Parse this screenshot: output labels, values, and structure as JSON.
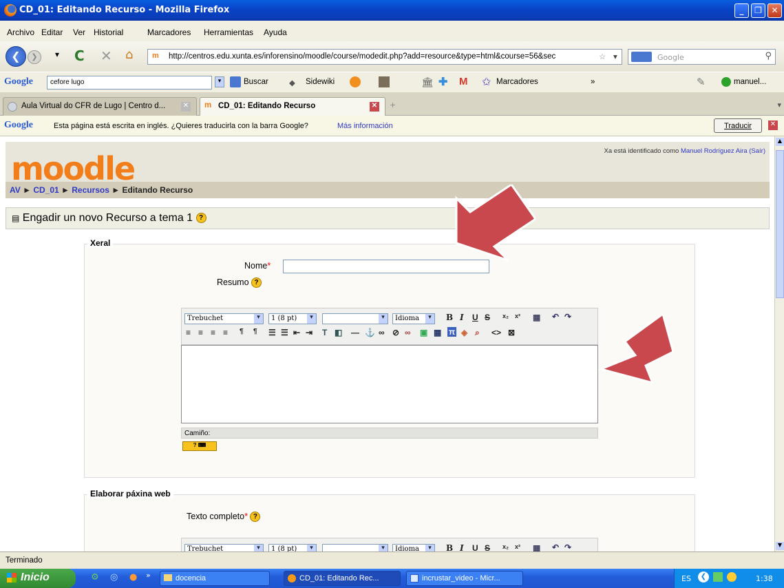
{
  "window": {
    "title": "CD_01: Editando Recurso - Mozilla Firefox"
  },
  "menu": [
    "Archivo",
    "Editar",
    "Ver",
    "Historial",
    "Marcadores",
    "Herramientas",
    "Ayuda"
  ],
  "nav": {
    "url": "http://centros.edu.xunta.es/inforensino/moodle/course/modedit.php?add=resource&type=html&course=56&sec",
    "search_placeholder": "Google"
  },
  "google_toolbar": {
    "search_value": "cefore lugo",
    "buscar": "Buscar",
    "sidewiki": "Sidewiki",
    "marcadores": "Marcadores",
    "user": "manuel..."
  },
  "tabs": [
    {
      "label": "Aula Virtual do CFR de Lugo | Centro d..."
    },
    {
      "label": "CD_01: Editando Recurso"
    }
  ],
  "translate_bar": {
    "message": "Esta página está escrita en inglés. ¿Quieres traducirla con la barra Google?",
    "more_info": "Más información",
    "translate_button": "Traducir"
  },
  "page": {
    "login_prefix": "Xa está identificado como",
    "login_user": "Manuel Rodríguez Aira",
    "logout": "(Saír)",
    "logo": "moodle",
    "breadcrumb": {
      "av": "AV",
      "course": "CD_01",
      "section": "Recursos",
      "current": "Editando Recurso"
    },
    "heading": "Engadir un novo Recurso a tema 1",
    "fieldset_general": "Xeral",
    "name_label": "Nome",
    "summary_label": "Resumo",
    "editor": {
      "font": "Trebuchet",
      "size": "1 (8 pt)",
      "lang": "Idioma",
      "path_label": "Camiño:"
    },
    "fieldset_web": "Elaborar páxina web",
    "fulltext_label": "Texto completo",
    "editor2": {
      "font": "Trebuchet",
      "size": "1 (8 pt)",
      "lang": "Idioma"
    }
  },
  "status": "Terminado",
  "taskbar": {
    "start": "Inicio",
    "items": [
      "docencia",
      "CD_01: Editando Rec...",
      "incrustar_video - Micr..."
    ],
    "lang": "ES",
    "clock": "1:38"
  },
  "colors": {
    "arrow": "#c8484d",
    "moodle_orange": "#f27d1b",
    "link": "#2e38c7"
  }
}
